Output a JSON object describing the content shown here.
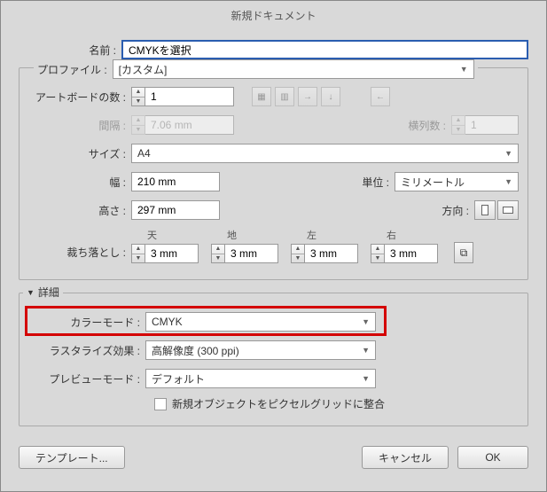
{
  "title": "新規ドキュメント",
  "name": {
    "label": "名前 :",
    "value": "CMYKを選択"
  },
  "profile": {
    "label": "プロファイル :",
    "value": "[カスタム]"
  },
  "artboards": {
    "label": "アートボードの数 :",
    "value": "1"
  },
  "spacing": {
    "label": "間隔 :",
    "value": "7.06 mm"
  },
  "columns": {
    "label": "横列数 :",
    "value": "1"
  },
  "size": {
    "label": "サイズ :",
    "value": "A4"
  },
  "width": {
    "label": "幅 :",
    "value": "210 mm"
  },
  "height": {
    "label": "高さ :",
    "value": "297 mm"
  },
  "units": {
    "label": "単位 :",
    "value": "ミリメートル"
  },
  "orientation": {
    "label": "方向 :"
  },
  "bleed": {
    "label": "裁ち落とし :",
    "top_lbl": "天",
    "bottom_lbl": "地",
    "left_lbl": "左",
    "right_lbl": "右",
    "top": "3 mm",
    "bottom": "3 mm",
    "left": "3 mm",
    "right": "3 mm"
  },
  "advanced": {
    "label": "詳細"
  },
  "colormode": {
    "label": "カラーモード :",
    "value": "CMYK"
  },
  "raster": {
    "label": "ラスタライズ効果 :",
    "value": "高解像度 (300 ppi)"
  },
  "preview": {
    "label": "プレビューモード :",
    "value": "デフォルト"
  },
  "pixelgrid": {
    "label": "新規オブジェクトをピクセルグリッドに整合"
  },
  "buttons": {
    "template": "テンプレート...",
    "cancel": "キャンセル",
    "ok": "OK"
  }
}
